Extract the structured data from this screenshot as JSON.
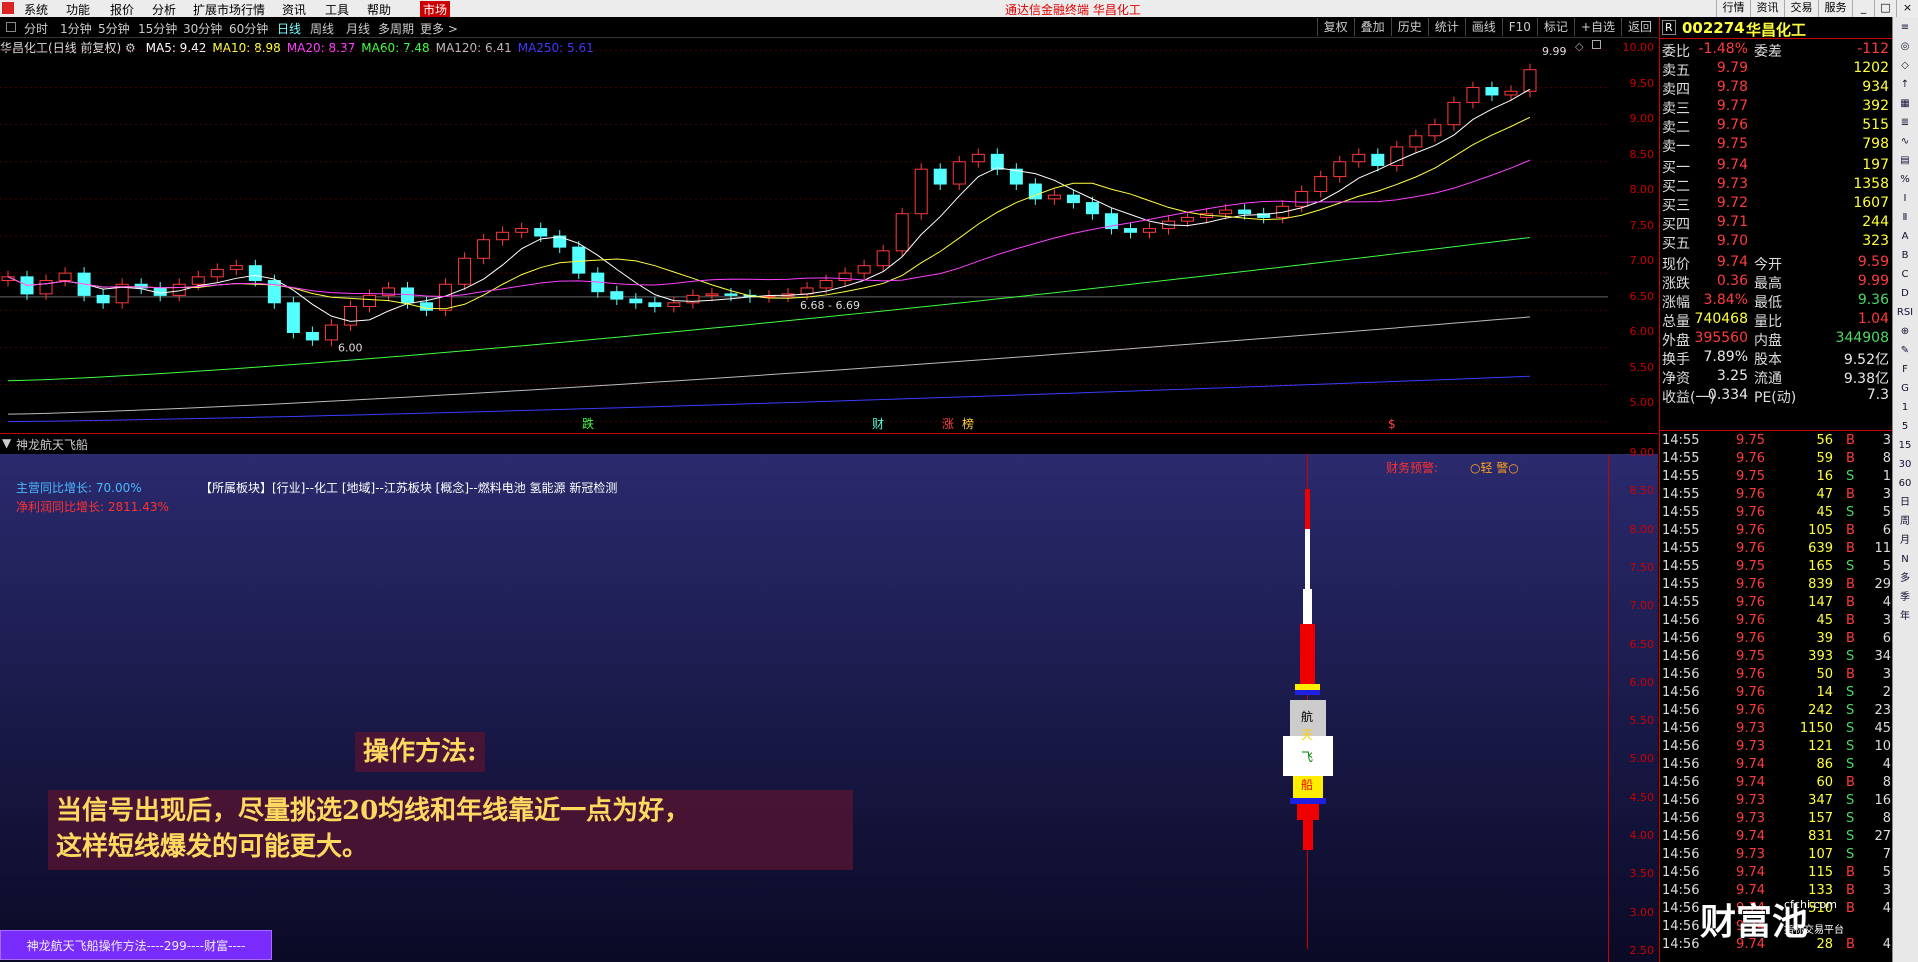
{
  "menu": {
    "items": [
      "系统",
      "功能",
      "报价",
      "分析",
      "扩展市场行情",
      "资讯",
      "工具",
      "帮助",
      "市场"
    ],
    "title": "通达信金融终端 华昌化工",
    "window_buttons": [
      "行情",
      "资讯",
      "交易",
      "服务",
      "_",
      "□",
      "×"
    ]
  },
  "periods": [
    "分时",
    "1分钟",
    "5分钟",
    "15分钟",
    "30分钟",
    "60分钟",
    "日线",
    "周线",
    "月线",
    "多周期",
    "更多 >"
  ],
  "active_period": "日线",
  "toolbar": [
    "复权",
    "叠加",
    "历史",
    "统计",
    "画线",
    "F10",
    "标记",
    "+自选",
    "返回"
  ],
  "main": {
    "name": "华昌化工",
    "mode": "(日线 前复权)",
    "ma": [
      {
        "label": "MA5: 9.42",
        "color": "#ffffff"
      },
      {
        "label": "MA10: 8.98",
        "color": "#ffff40"
      },
      {
        "label": "MA20: 8.37",
        "color": "#ff40ff"
      },
      {
        "label": "MA60: 7.48",
        "color": "#40ff40"
      },
      {
        "label": "MA120: 6.41",
        "color": "#bbbbbb"
      },
      {
        "label": "MA250: 5.61",
        "color": "#3c3cff"
      }
    ],
    "high_label": "9.99",
    "low_label": "6.00",
    "mid_label": "6.68 - 6.69",
    "markers": [
      {
        "text": "跌",
        "color": "#40ff40"
      },
      {
        "text": "财",
        "color": "#5fd"
      },
      {
        "text": "涨",
        "color": "#ff4040"
      },
      {
        "text": "榜",
        "color": "#ffcc40"
      },
      {
        "text": "$",
        "color": "#ff4040"
      }
    ],
    "yaxis": [
      "10.00",
      "9.50",
      "9.00",
      "8.50",
      "8.00",
      "7.50",
      "7.00",
      "6.50",
      "6.00",
      "5.50",
      "5.00"
    ]
  },
  "indicator": {
    "name": "神龙航天飞船",
    "growth1_label": "主营同比增长: 70.00%",
    "growth2_label": "净利润同比增长: 2811.43%",
    "sector_text": "【所属板块】[行业]--化工 [地域]--江苏板块 [概念]--燃料电池 氢能源 新冠检测",
    "warning_label": "财务预警:",
    "warning_value": "○轻 警○",
    "rocket_chars": [
      "航",
      "天",
      "飞",
      "船"
    ],
    "title": "操作方法:",
    "note_line1": "当信号出现后，尽量挑选20均线和年线靠近一点为好，",
    "note_line2": "这样短线爆发的可能更大。",
    "yaxis": [
      "9.00",
      "8.50",
      "8.00",
      "7.50",
      "7.00",
      "6.50",
      "6.00",
      "5.50",
      "5.00",
      "4.50",
      "4.00",
      "3.50",
      "3.00",
      "2.50"
    ]
  },
  "bottom_label": "神龙航天飞船操作方法----299----财富----",
  "quote": {
    "code": "002274",
    "name": "华昌化工",
    "weibi_label": "委比",
    "weibi": "-1.48%",
    "weicha_label": "委差",
    "weicha": "-112",
    "sells": [
      {
        "label": "卖五",
        "price": "9.79",
        "vol": "1202"
      },
      {
        "label": "卖四",
        "price": "9.78",
        "vol": "934"
      },
      {
        "label": "卖三",
        "price": "9.77",
        "vol": "392"
      },
      {
        "label": "卖二",
        "price": "9.76",
        "vol": "515"
      },
      {
        "label": "卖一",
        "price": "9.75",
        "vol": "798"
      }
    ],
    "buys": [
      {
        "label": "买一",
        "price": "9.74",
        "vol": "197"
      },
      {
        "label": "买二",
        "price": "9.73",
        "vol": "1358"
      },
      {
        "label": "买三",
        "price": "9.72",
        "vol": "1607"
      },
      {
        "label": "买四",
        "price": "9.71",
        "vol": "244"
      },
      {
        "label": "买五",
        "price": "9.70",
        "vol": "323"
      }
    ],
    "stats": [
      {
        "l1": "现价",
        "v1": "9.74",
        "c1": "#ff3b3b",
        "l2": "今开",
        "v2": "9.59",
        "c2": "#ff3b3b"
      },
      {
        "l1": "涨跌",
        "v1": "0.36",
        "c1": "#ff3b3b",
        "l2": "最高",
        "v2": "9.99",
        "c2": "#ff3b3b"
      },
      {
        "l1": "涨幅",
        "v1": "3.84%",
        "c1": "#ff3b3b",
        "l2": "最低",
        "v2": "9.36",
        "c2": "#4cd964"
      },
      {
        "l1": "总量",
        "v1": "740468",
        "c1": "#ffff3b",
        "l2": "量比",
        "v2": "1.04",
        "c2": "#ff3b3b"
      },
      {
        "l1": "外盘",
        "v1": "395560",
        "c1": "#ff3b3b",
        "l2": "内盘",
        "v2": "344908",
        "c2": "#4cd964"
      },
      {
        "l1": "换手",
        "v1": "7.89%",
        "c1": "#e8e8e8",
        "l2": "股本",
        "v2": "9.52亿",
        "c2": "#e8e8e8"
      },
      {
        "l1": "净资",
        "v1": "3.25",
        "c1": "#e8e8e8",
        "l2": "流通",
        "v2": "9.38亿",
        "c2": "#e8e8e8"
      },
      {
        "l1": "收益(一)",
        "v1": "0.334",
        "c1": "#e8e8e8",
        "l2": "PE(动)",
        "v2": "7.3",
        "c2": "#e8e8e8"
      }
    ],
    "ticks": [
      {
        "t": "14:55",
        "p": "9.75",
        "v": "56",
        "d": "B",
        "n": "3"
      },
      {
        "t": "14:55",
        "p": "9.76",
        "v": "59",
        "d": "B",
        "n": "8"
      },
      {
        "t": "14:55",
        "p": "9.75",
        "v": "16",
        "d": "S",
        "n": "1"
      },
      {
        "t": "14:55",
        "p": "9.76",
        "v": "47",
        "d": "B",
        "n": "3"
      },
      {
        "t": "14:55",
        "p": "9.76",
        "v": "45",
        "d": "S",
        "n": "5"
      },
      {
        "t": "14:55",
        "p": "9.76",
        "v": "105",
        "d": "B",
        "n": "6"
      },
      {
        "t": "14:55",
        "p": "9.76",
        "v": "639",
        "d": "B",
        "n": "11"
      },
      {
        "t": "14:55",
        "p": "9.75",
        "v": "165",
        "d": "S",
        "n": "5"
      },
      {
        "t": "14:55",
        "p": "9.76",
        "v": "839",
        "d": "B",
        "n": "29"
      },
      {
        "t": "14:55",
        "p": "9.76",
        "v": "147",
        "d": "B",
        "n": "4"
      },
      {
        "t": "14:56",
        "p": "9.76",
        "v": "45",
        "d": "B",
        "n": "3"
      },
      {
        "t": "14:56",
        "p": "9.76",
        "v": "39",
        "d": "B",
        "n": "6"
      },
      {
        "t": "14:56",
        "p": "9.75",
        "v": "393",
        "d": "S",
        "n": "34"
      },
      {
        "t": "14:56",
        "p": "9.76",
        "v": "50",
        "d": "B",
        "n": "3"
      },
      {
        "t": "14:56",
        "p": "9.76",
        "v": "14",
        "d": "S",
        "n": "2"
      },
      {
        "t": "14:56",
        "p": "9.76",
        "v": "242",
        "d": "S",
        "n": "23"
      },
      {
        "t": "14:56",
        "p": "9.73",
        "v": "1150",
        "d": "S",
        "n": "45"
      },
      {
        "t": "14:56",
        "p": "9.73",
        "v": "121",
        "d": "S",
        "n": "10"
      },
      {
        "t": "14:56",
        "p": "9.74",
        "v": "86",
        "d": "S",
        "n": "4"
      },
      {
        "t": "14:56",
        "p": "9.74",
        "v": "60",
        "d": "B",
        "n": "8"
      },
      {
        "t": "14:56",
        "p": "9.73",
        "v": "347",
        "d": "S",
        "n": "16"
      },
      {
        "t": "14:56",
        "p": "9.73",
        "v": "157",
        "d": "S",
        "n": "8"
      },
      {
        "t": "14:56",
        "p": "9.74",
        "v": "831",
        "d": "S",
        "n": "27"
      },
      {
        "t": "14:56",
        "p": "9.73",
        "v": "107",
        "d": "S",
        "n": "7"
      },
      {
        "t": "14:56",
        "p": "9.74",
        "v": "115",
        "d": "B",
        "n": "5"
      },
      {
        "t": "14:56",
        "p": "9.74",
        "v": "133",
        "d": "B",
        "n": "3"
      },
      {
        "t": "14:56",
        "p": "9.74",
        "v": "510",
        "d": "B",
        "n": "4"
      },
      {
        "t": "14:56",
        "p": "9.74",
        "v": "",
        "d": "",
        "n": ""
      },
      {
        "t": "14:56",
        "p": "9.74",
        "v": "28",
        "d": "B",
        "n": "4"
      }
    ]
  },
  "sidebar": [
    "≡",
    "◎",
    "◇",
    "↑",
    "▦",
    "≣",
    "∿",
    "▤",
    "%",
    "Ⅰ",
    "Ⅱ",
    "A",
    "B",
    "C",
    "D",
    "RSI",
    "⊕",
    "✎",
    "F",
    "G",
    "1",
    "5",
    "15",
    "30",
    "60",
    "日",
    "周",
    "月",
    "N",
    "多",
    "季",
    "年"
  ],
  "watermark": {
    "logo": "财富池",
    "sub": "cfchi.com",
    "sub2": "指标交易平台"
  },
  "colors": {
    "up": "#ff3b3b",
    "down": "#4cd964",
    "accent": "#7ff"
  }
}
